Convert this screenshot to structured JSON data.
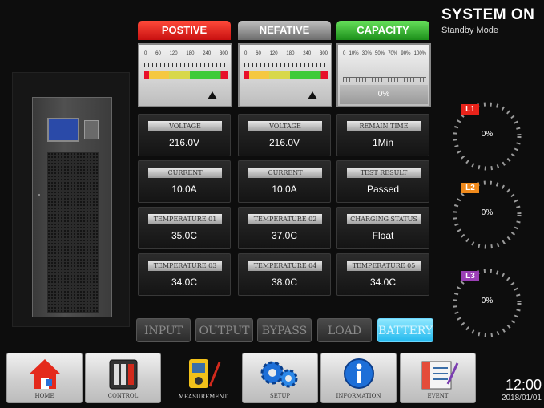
{
  "status": {
    "system": "SYSTEM ON",
    "mode": "Standby Mode"
  },
  "columns": {
    "positive": {
      "title": "POSTIVE",
      "scale": [
        "0",
        "60",
        "120",
        "180",
        "240",
        "300"
      ],
      "level": 0.82
    },
    "negative": {
      "title": "NEFATIVE",
      "scale": [
        "0",
        "60",
        "120",
        "180",
        "240",
        "300"
      ],
      "level": 0.82
    },
    "capacity": {
      "title": "CAPACITY",
      "scale": [
        "0",
        "10%",
        "30%",
        "50%",
        "70%",
        "90%",
        "100%"
      ],
      "value": "0%"
    }
  },
  "cells": {
    "r1": [
      {
        "label": "VOLTAGE",
        "value": "216.0V"
      },
      {
        "label": "VOLTAGE",
        "value": "216.0V"
      },
      {
        "label": "REMAIN TIME",
        "value": "1Min"
      }
    ],
    "r2": [
      {
        "label": "CURRENT",
        "value": "10.0A"
      },
      {
        "label": "CURRENT",
        "value": "10.0A"
      },
      {
        "label": "TEST RESULT",
        "value": "Passed"
      }
    ],
    "r3": [
      {
        "label": "TEMPERATURE 01",
        "value": "35.0C"
      },
      {
        "label": "TEMPERATURE 02",
        "value": "37.0C"
      },
      {
        "label": "CHARGING STATUS",
        "value": "Float"
      }
    ],
    "r4": [
      {
        "label": "TEMPERATURE 03",
        "value": "34.0C"
      },
      {
        "label": "TEMPERATURE 04",
        "value": "38.0C"
      },
      {
        "label": "TEMPERATURE 05",
        "value": "34.0C"
      }
    ]
  },
  "subtabs": [
    "INPUT",
    "OUTPUT",
    "BYPASS",
    "LOAD",
    "BATTERY"
  ],
  "phases": [
    {
      "tag": "L1",
      "value": "0%",
      "color": "#e8231a"
    },
    {
      "tag": "L2",
      "value": "0%",
      "color": "#f08a1c"
    },
    {
      "tag": "L3",
      "value": "0%",
      "color": "#9a3fb5"
    }
  ],
  "nav": [
    {
      "label": "HOME",
      "icon": "home-icon"
    },
    {
      "label": "CONTROL",
      "icon": "control-icon"
    },
    {
      "label": "MEASUREMENT",
      "icon": "measurement-icon"
    },
    {
      "label": "SETUP",
      "icon": "gears-icon"
    },
    {
      "label": "INFORMATION",
      "icon": "info-icon"
    },
    {
      "label": "EVENT",
      "icon": "event-icon"
    }
  ],
  "clock": {
    "time": "12:00",
    "date": "2018/01/01"
  }
}
